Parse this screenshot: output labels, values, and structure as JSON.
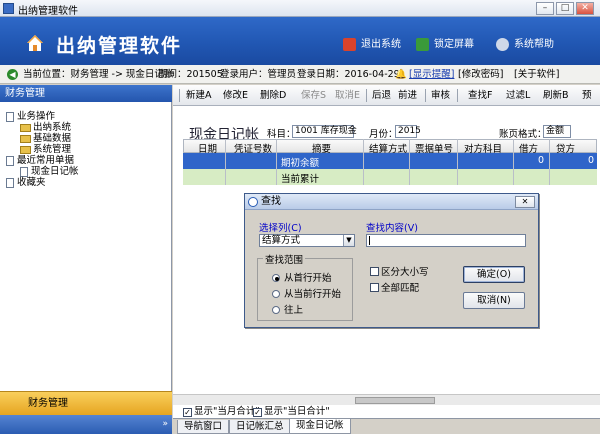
{
  "window": {
    "title": "出纳管理软件"
  },
  "banner": {
    "app_title": "出纳管理软件",
    "buttons": [
      {
        "label": "退出系统",
        "icon": "exit-icon",
        "color": "#d9432c"
      },
      {
        "label": "锁定屏幕",
        "icon": "lock-icon",
        "color": "#3a9a3a"
      },
      {
        "label": "系统帮助",
        "icon": "help-icon",
        "color": "#cfd8e8"
      }
    ]
  },
  "status": {
    "location": "当前位置：财务管理 -> 现金日记账",
    "period": "期间：201505",
    "user": "登录用户：管理员",
    "login_date": "登录日期：2016-04-29",
    "show_reminder": "[显示提醒]",
    "change_password": "[修改密码]",
    "about": "[关于软件]"
  },
  "sidebar": {
    "header": "财务管理",
    "tree": [
      {
        "label": "业务操作",
        "type": "root"
      },
      {
        "label": "出纳系统",
        "type": "folder"
      },
      {
        "label": "基础数据",
        "type": "folder"
      },
      {
        "label": "系统管理",
        "type": "folder"
      },
      {
        "label": "最近常用单据",
        "type": "root"
      },
      {
        "label": "现金日记帐",
        "type": "doc"
      },
      {
        "label": "收藏夹",
        "type": "root"
      }
    ],
    "footer": "财务管理"
  },
  "toolbar": {
    "items": [
      "新建A",
      "修改E",
      "删除D",
      "保存S",
      "取消E",
      "后退",
      "前进",
      "审核",
      "查找F",
      "过滤L",
      "刷新B",
      "预"
    ]
  },
  "main": {
    "title": "现金日记帐",
    "account_label": "科目：",
    "account_value": "1001 库存现金",
    "month_label": "月份：",
    "month_value": "2015",
    "format_label": "账页格式：",
    "format_value": "金额",
    "columns": [
      "日期",
      "凭证号数",
      "摘要",
      "结算方式",
      "票据单号",
      "对方科目",
      "借方",
      "贷方"
    ],
    "rows": [
      {
        "summary": "期初余额",
        "debit": "0",
        "credit": "0"
      },
      {
        "summary": "当前累计",
        "debit": "",
        "credit": ""
      }
    ]
  },
  "bottom": {
    "show_month_total": "显示\"当月合计\"",
    "show_day_total": "显示\"当日合计\"",
    "tabs": [
      "导航窗口",
      "日记帐汇总",
      "现金日记帐"
    ]
  },
  "dialog": {
    "title": "查找",
    "select_column_label": "选择列(C)",
    "select_column_value": "结算方式",
    "content_label": "查找内容(V)",
    "content_value": "",
    "range_title": "查找范围",
    "ranges": [
      "从首行开始",
      "从当前行开始",
      "往上"
    ],
    "case_sensitive": "区分大小写",
    "match_all": "全部匹配",
    "ok": "确定(O)",
    "cancel": "取消(N)"
  }
}
